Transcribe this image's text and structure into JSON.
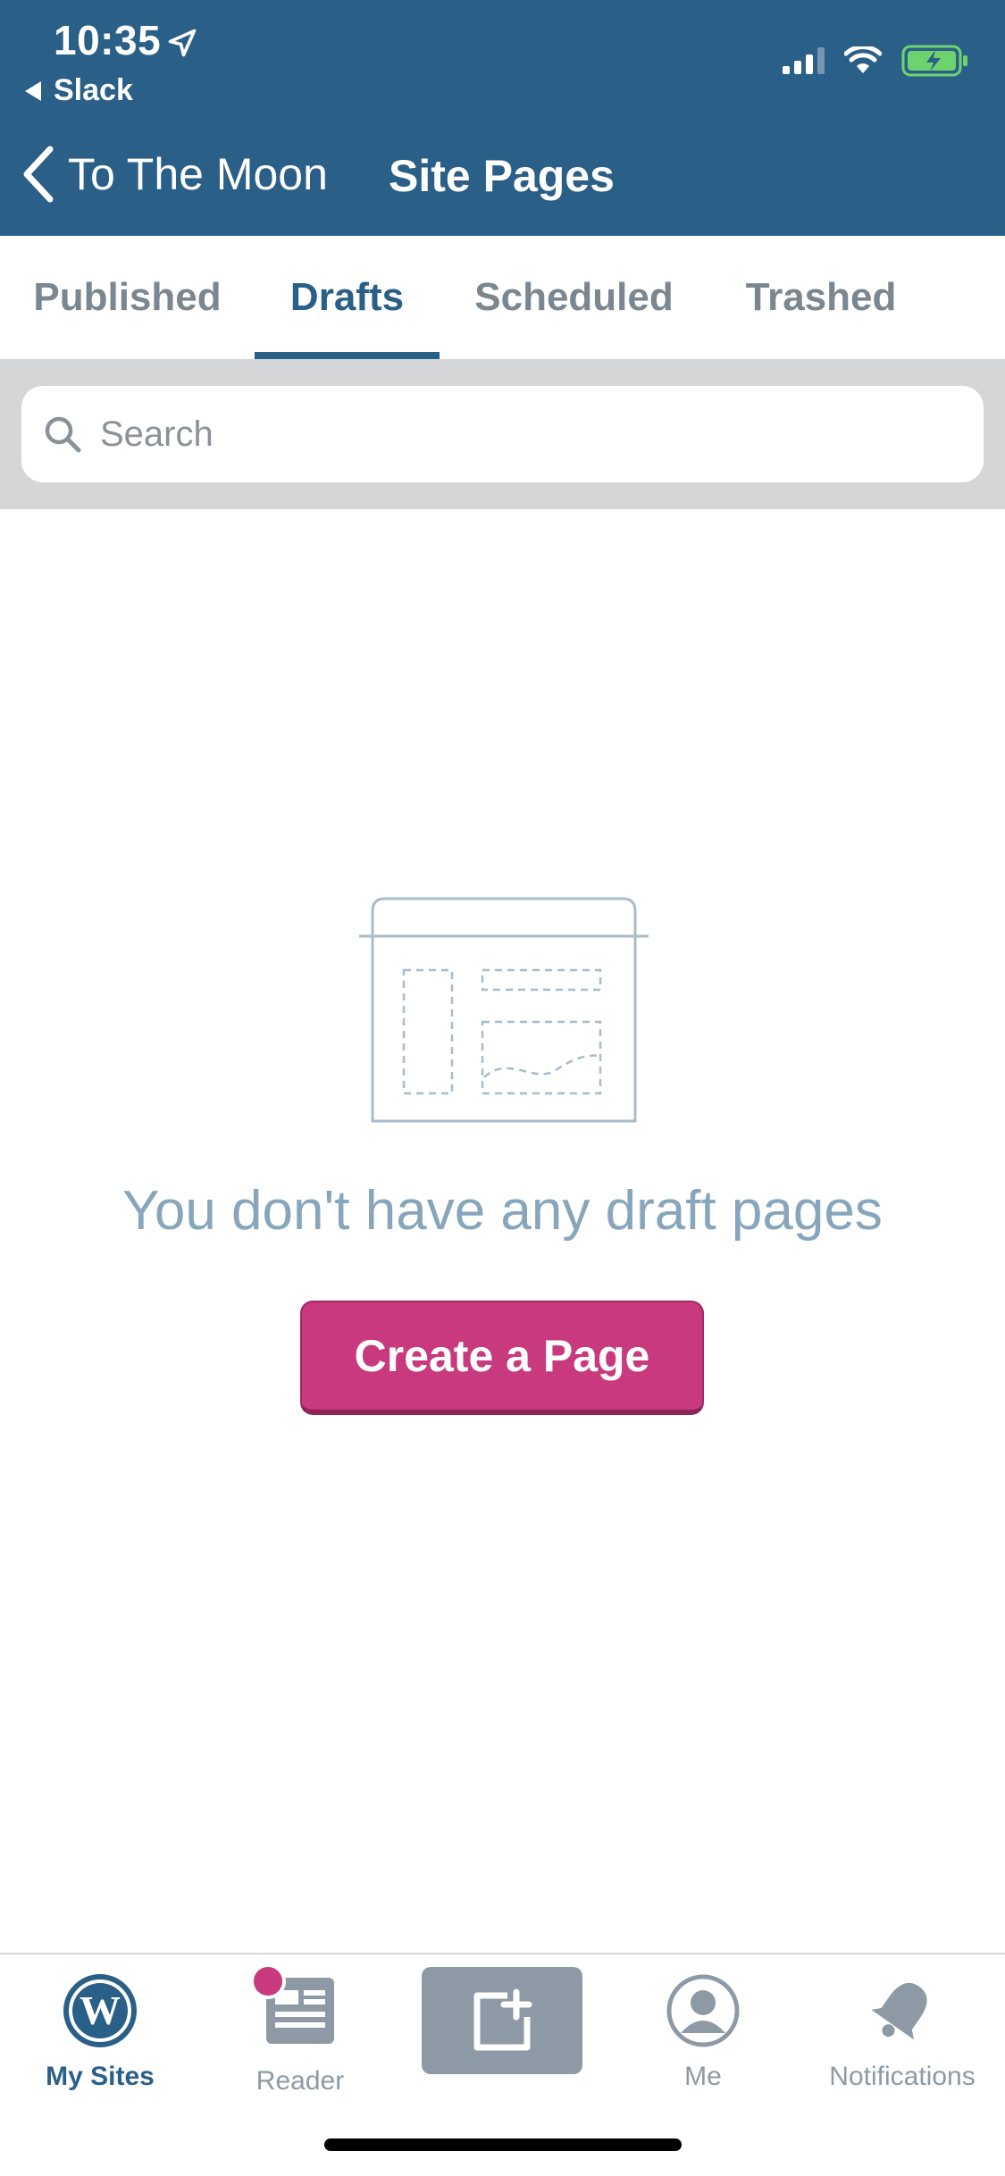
{
  "status_bar": {
    "time": "10:35",
    "back_app": "Slack"
  },
  "nav": {
    "back_label": "To The Moon",
    "title": "Site Pages"
  },
  "tabs": [
    {
      "label": "Published",
      "active": false
    },
    {
      "label": "Drafts",
      "active": true
    },
    {
      "label": "Scheduled",
      "active": false
    },
    {
      "label": "Trashed",
      "active": false
    }
  ],
  "search": {
    "placeholder": "Search",
    "value": ""
  },
  "empty_state": {
    "message": "You don't have any draft pages",
    "button_label": "Create a Page"
  },
  "tabbar": {
    "items": [
      {
        "label": "My Sites",
        "icon": "wordpress-icon",
        "active": true
      },
      {
        "label": "Reader",
        "icon": "reader-icon",
        "active": false,
        "badge": true
      },
      {
        "label": "",
        "icon": "new-post-icon",
        "active": false
      },
      {
        "label": "Me",
        "icon": "user-icon",
        "active": false
      },
      {
        "label": "Notifications",
        "icon": "bell-icon",
        "active": false
      }
    ]
  },
  "colors": {
    "header": "#2a5f88",
    "accent": "#c9397e",
    "muted": "#87a6bc",
    "battery": "#6ed36e"
  }
}
